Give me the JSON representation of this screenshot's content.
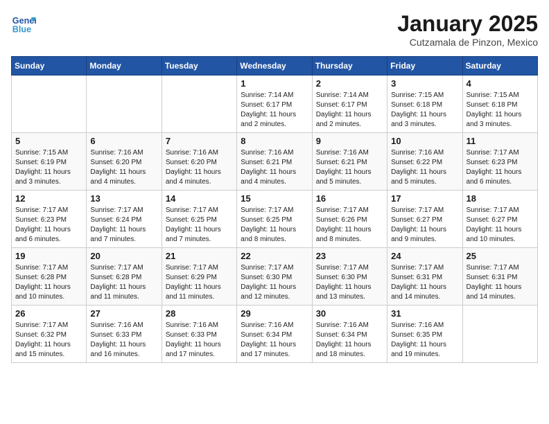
{
  "header": {
    "logo_line1": "General",
    "logo_line2": "Blue",
    "month": "January 2025",
    "location": "Cutzamala de Pinzon, Mexico"
  },
  "days_of_week": [
    "Sunday",
    "Monday",
    "Tuesday",
    "Wednesday",
    "Thursday",
    "Friday",
    "Saturday"
  ],
  "weeks": [
    [
      {
        "num": "",
        "info": ""
      },
      {
        "num": "",
        "info": ""
      },
      {
        "num": "",
        "info": ""
      },
      {
        "num": "1",
        "info": "Sunrise: 7:14 AM\nSunset: 6:17 PM\nDaylight: 11 hours\nand 2 minutes."
      },
      {
        "num": "2",
        "info": "Sunrise: 7:14 AM\nSunset: 6:17 PM\nDaylight: 11 hours\nand 2 minutes."
      },
      {
        "num": "3",
        "info": "Sunrise: 7:15 AM\nSunset: 6:18 PM\nDaylight: 11 hours\nand 3 minutes."
      },
      {
        "num": "4",
        "info": "Sunrise: 7:15 AM\nSunset: 6:18 PM\nDaylight: 11 hours\nand 3 minutes."
      }
    ],
    [
      {
        "num": "5",
        "info": "Sunrise: 7:15 AM\nSunset: 6:19 PM\nDaylight: 11 hours\nand 3 minutes."
      },
      {
        "num": "6",
        "info": "Sunrise: 7:16 AM\nSunset: 6:20 PM\nDaylight: 11 hours\nand 4 minutes."
      },
      {
        "num": "7",
        "info": "Sunrise: 7:16 AM\nSunset: 6:20 PM\nDaylight: 11 hours\nand 4 minutes."
      },
      {
        "num": "8",
        "info": "Sunrise: 7:16 AM\nSunset: 6:21 PM\nDaylight: 11 hours\nand 4 minutes."
      },
      {
        "num": "9",
        "info": "Sunrise: 7:16 AM\nSunset: 6:21 PM\nDaylight: 11 hours\nand 5 minutes."
      },
      {
        "num": "10",
        "info": "Sunrise: 7:16 AM\nSunset: 6:22 PM\nDaylight: 11 hours\nand 5 minutes."
      },
      {
        "num": "11",
        "info": "Sunrise: 7:17 AM\nSunset: 6:23 PM\nDaylight: 11 hours\nand 6 minutes."
      }
    ],
    [
      {
        "num": "12",
        "info": "Sunrise: 7:17 AM\nSunset: 6:23 PM\nDaylight: 11 hours\nand 6 minutes."
      },
      {
        "num": "13",
        "info": "Sunrise: 7:17 AM\nSunset: 6:24 PM\nDaylight: 11 hours\nand 7 minutes."
      },
      {
        "num": "14",
        "info": "Sunrise: 7:17 AM\nSunset: 6:25 PM\nDaylight: 11 hours\nand 7 minutes."
      },
      {
        "num": "15",
        "info": "Sunrise: 7:17 AM\nSunset: 6:25 PM\nDaylight: 11 hours\nand 8 minutes."
      },
      {
        "num": "16",
        "info": "Sunrise: 7:17 AM\nSunset: 6:26 PM\nDaylight: 11 hours\nand 8 minutes."
      },
      {
        "num": "17",
        "info": "Sunrise: 7:17 AM\nSunset: 6:27 PM\nDaylight: 11 hours\nand 9 minutes."
      },
      {
        "num": "18",
        "info": "Sunrise: 7:17 AM\nSunset: 6:27 PM\nDaylight: 11 hours\nand 10 minutes."
      }
    ],
    [
      {
        "num": "19",
        "info": "Sunrise: 7:17 AM\nSunset: 6:28 PM\nDaylight: 11 hours\nand 10 minutes."
      },
      {
        "num": "20",
        "info": "Sunrise: 7:17 AM\nSunset: 6:28 PM\nDaylight: 11 hours\nand 11 minutes."
      },
      {
        "num": "21",
        "info": "Sunrise: 7:17 AM\nSunset: 6:29 PM\nDaylight: 11 hours\nand 11 minutes."
      },
      {
        "num": "22",
        "info": "Sunrise: 7:17 AM\nSunset: 6:30 PM\nDaylight: 11 hours\nand 12 minutes."
      },
      {
        "num": "23",
        "info": "Sunrise: 7:17 AM\nSunset: 6:30 PM\nDaylight: 11 hours\nand 13 minutes."
      },
      {
        "num": "24",
        "info": "Sunrise: 7:17 AM\nSunset: 6:31 PM\nDaylight: 11 hours\nand 14 minutes."
      },
      {
        "num": "25",
        "info": "Sunrise: 7:17 AM\nSunset: 6:31 PM\nDaylight: 11 hours\nand 14 minutes."
      }
    ],
    [
      {
        "num": "26",
        "info": "Sunrise: 7:17 AM\nSunset: 6:32 PM\nDaylight: 11 hours\nand 15 minutes."
      },
      {
        "num": "27",
        "info": "Sunrise: 7:16 AM\nSunset: 6:33 PM\nDaylight: 11 hours\nand 16 minutes."
      },
      {
        "num": "28",
        "info": "Sunrise: 7:16 AM\nSunset: 6:33 PM\nDaylight: 11 hours\nand 17 minutes."
      },
      {
        "num": "29",
        "info": "Sunrise: 7:16 AM\nSunset: 6:34 PM\nDaylight: 11 hours\nand 17 minutes."
      },
      {
        "num": "30",
        "info": "Sunrise: 7:16 AM\nSunset: 6:34 PM\nDaylight: 11 hours\nand 18 minutes."
      },
      {
        "num": "31",
        "info": "Sunrise: 7:16 AM\nSunset: 6:35 PM\nDaylight: 11 hours\nand 19 minutes."
      },
      {
        "num": "",
        "info": ""
      }
    ]
  ]
}
